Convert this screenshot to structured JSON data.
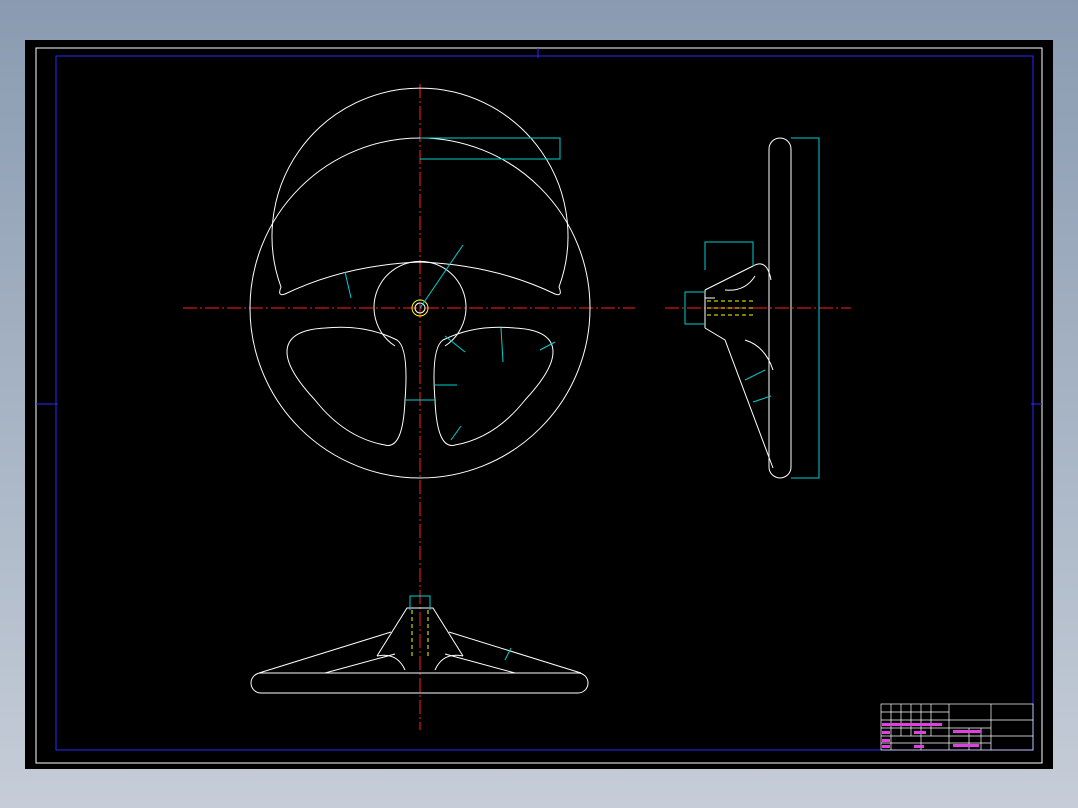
{
  "drawing": {
    "background_color": "#000000",
    "border_color": "#0000ff",
    "outline_color": "#ffffff",
    "centerline_color": "#ff2020",
    "dimension_color": "#00d0d0",
    "hidden_line_color": "#ffff00",
    "title_text_color": "#e040e0"
  },
  "title_block": {
    "cells": []
  }
}
